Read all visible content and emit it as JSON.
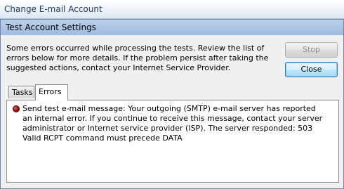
{
  "window": {
    "title": "Change E-mail Account"
  },
  "dialog": {
    "title": "Test Account Settings",
    "message": "Some errors occurred while processing the tests. Review the list of errors below for more details. If the problem persist after taking the suggested actions, contact your Internet Service Provider.",
    "stop_label": "Stop",
    "close_label": "Close",
    "tabs": [
      {
        "label": "Tasks",
        "selected": false
      },
      {
        "label": "Errors",
        "selected": true
      }
    ],
    "errors": [
      {
        "icon": "error-icon",
        "text": "Send test e-mail message: Your outgoing (SMTP) e-mail server has reported an internal error. If you continue to receive this message, contact your server administrator or Internet service provider (ISP).  The server responded: 503 Valid RCPT command must precede DATA"
      }
    ]
  },
  "colors": {
    "dialog_titlebar": "#9fbbe0",
    "error_icon": "#9b1414",
    "close_button_border": "#3c7fb1"
  }
}
